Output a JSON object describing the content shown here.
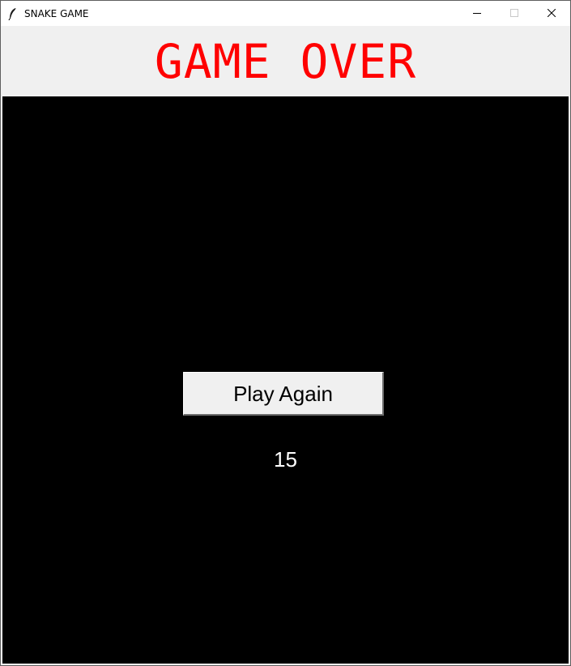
{
  "window": {
    "title": "SNAKE GAME",
    "icon": "feather-icon",
    "controls": {
      "minimize_icon": "minimize-icon",
      "maximize_icon": "maximize-icon",
      "close_icon": "close-icon"
    }
  },
  "header": {
    "status_text": "GAME OVER",
    "status_color": "#ff0000"
  },
  "game": {
    "canvas_color": "#000000",
    "play_again_label": "Play Again",
    "final_score": "15"
  }
}
